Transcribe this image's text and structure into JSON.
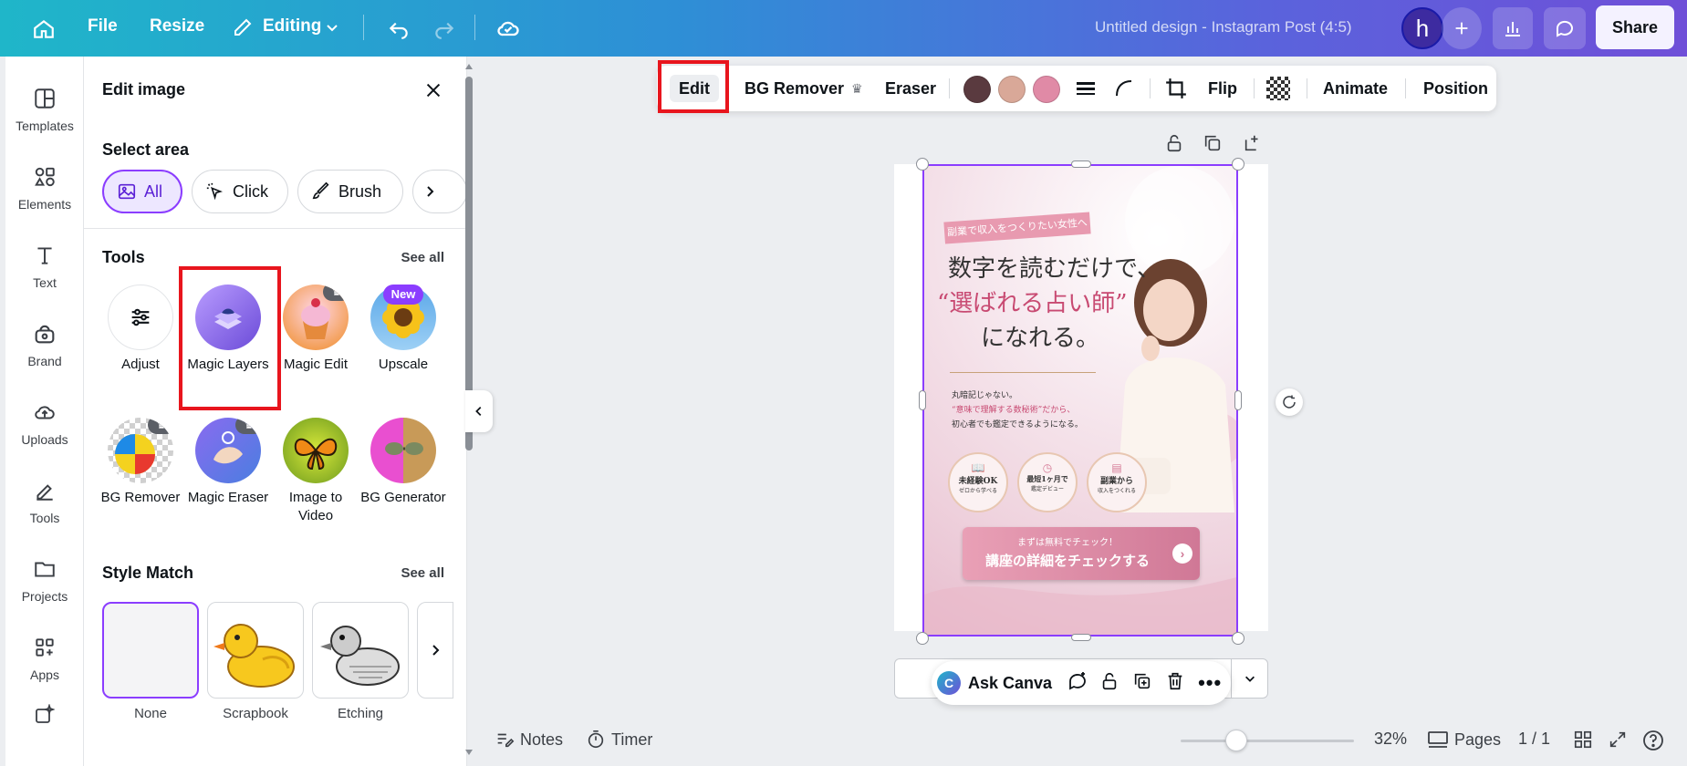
{
  "topbar": {
    "file": "File",
    "resize": "Resize",
    "mode": "Editing",
    "doc_title": "Untitled design - Instagram Post (4:5)",
    "avatar_letter": "h",
    "share": "Share",
    "bg_gradient": [
      "#1fb6c9",
      "#6f4fd8"
    ]
  },
  "rail": {
    "items": [
      {
        "label": "Templates",
        "icon": "templates-icon"
      },
      {
        "label": "Elements",
        "icon": "elements-icon"
      },
      {
        "label": "Text",
        "icon": "text-icon"
      },
      {
        "label": "Brand",
        "icon": "brand-icon"
      },
      {
        "label": "Uploads",
        "icon": "uploads-icon"
      },
      {
        "label": "Tools",
        "icon": "tools-icon"
      },
      {
        "label": "Projects",
        "icon": "projects-icon"
      },
      {
        "label": "Apps",
        "icon": "apps-icon"
      }
    ]
  },
  "panel": {
    "title": "Edit image",
    "select_area": {
      "heading": "Select area",
      "options": [
        "All",
        "Click",
        "Brush"
      ],
      "selected": "All"
    },
    "tools": {
      "heading": "Tools",
      "see_all": "See all",
      "items": [
        {
          "label": "Adjust"
        },
        {
          "label": "Magic Layers"
        },
        {
          "label": "Magic Edit"
        },
        {
          "label": "Upscale",
          "badge": "New"
        },
        {
          "label": "BG Remover"
        },
        {
          "label": "Magic Eraser"
        },
        {
          "label": "Image to Video"
        },
        {
          "label": "BG Generator"
        }
      ]
    },
    "style_match": {
      "heading": "Style Match",
      "see_all": "See all",
      "items": [
        "None",
        "Scrapbook",
        "Etching"
      ]
    }
  },
  "context_toolbar": {
    "edit": "Edit",
    "bg_remover": "BG Remover",
    "eraser": "Eraser",
    "swatches": [
      "#5a3a3f",
      "#d9a898",
      "#e08aa6"
    ],
    "flip": "Flip",
    "animate": "Animate",
    "position": "Position"
  },
  "design": {
    "ribbon": "副業で収入をつくりたい女性へ",
    "headline_1": "数字を読むだけで、",
    "headline_2": "“選ばれる占い師”",
    "headline_3": "になれる。",
    "body_1": "丸暗記じゃない。",
    "body_2": "“意味で理解する数秘術”だから、",
    "body_3": "初心者でも鑑定できるようになる。",
    "badges": [
      {
        "title": "未経験OK",
        "sub": "ゼロから学べる"
      },
      {
        "title": "最短1ヶ月で",
        "sub": "鑑定デビュー"
      },
      {
        "title": "副業から",
        "sub": "収入をつくれる"
      }
    ],
    "cta_small": "まずは無料でチェック！",
    "cta_main": "講座の詳細をチェックする"
  },
  "ask_bar": {
    "label": "Ask Canva"
  },
  "footer": {
    "notes": "Notes",
    "timer": "Timer",
    "zoom": "32%",
    "zoom_level": 0.32,
    "pages": "Pages",
    "page_count": "1 / 1"
  }
}
